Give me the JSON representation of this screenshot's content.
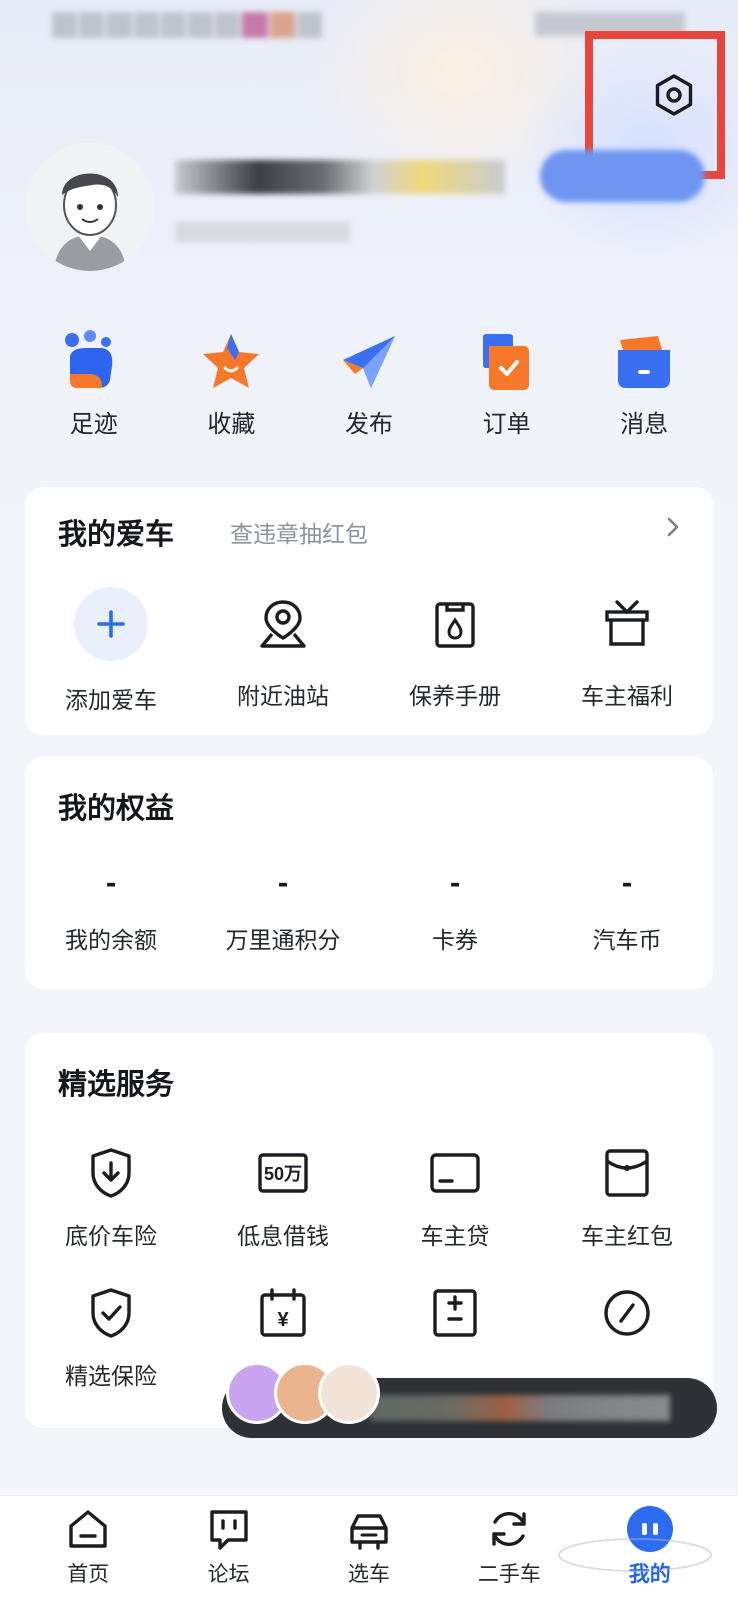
{
  "quick_actions": [
    {
      "label": "足迹",
      "icon": "footprint-icon"
    },
    {
      "label": "收藏",
      "icon": "star-icon"
    },
    {
      "label": "发布",
      "icon": "paper-plane-icon"
    },
    {
      "label": "订单",
      "icon": "order-icon"
    },
    {
      "label": "消息",
      "icon": "message-icon"
    }
  ],
  "my_car": {
    "title": "我的爱车",
    "subtitle": "查违章抽红包",
    "items": [
      {
        "label": "添加爱车",
        "icon": "plus-icon"
      },
      {
        "label": "附近油站",
        "icon": "location-pin-icon"
      },
      {
        "label": "保养手册",
        "icon": "maintenance-manual-icon"
      },
      {
        "label": "车主福利",
        "icon": "gift-icon"
      }
    ]
  },
  "benefits": {
    "title": "我的权益",
    "items": [
      {
        "value": "-",
        "label": "我的余额"
      },
      {
        "value": "-",
        "label": "万里通积分"
      },
      {
        "value": "-",
        "label": "卡券"
      },
      {
        "value": "-",
        "label": "汽车币"
      }
    ]
  },
  "services": {
    "title": "精选服务",
    "row1": [
      {
        "label": "底价车险",
        "icon": "shield-download-icon"
      },
      {
        "label": "低息借钱",
        "icon": "50wan-badge-icon",
        "icon_text": "50万"
      },
      {
        "label": "车主贷",
        "icon": "card-icon"
      },
      {
        "label": "车主红包",
        "icon": "red-envelope-icon"
      }
    ],
    "row2": [
      {
        "label": "精选保险",
        "icon": "shield-check-icon"
      },
      {
        "label": "",
        "icon": "calendar-yen-icon",
        "icon_text": "¥"
      },
      {
        "label": "",
        "icon": "calculator-icon"
      },
      {
        "label": "",
        "icon": "gauge-icon"
      }
    ]
  },
  "tabbar": [
    {
      "label": "首页",
      "icon": "home-icon"
    },
    {
      "label": "论坛",
      "icon": "forum-icon"
    },
    {
      "label": "选车",
      "icon": "car-icon"
    },
    {
      "label": "二手车",
      "icon": "refresh-icon"
    },
    {
      "label": "我的",
      "icon": "profile-icon",
      "active": true
    }
  ],
  "colors": {
    "accent": "#2d6cf0",
    "highlight_box": "#e8463d",
    "orange": "#f7782a"
  }
}
